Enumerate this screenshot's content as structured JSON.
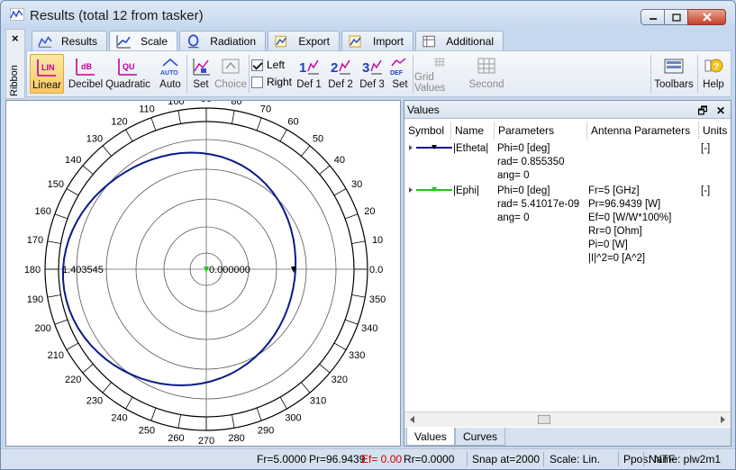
{
  "window": {
    "title": "Results (total 12 from tasker)"
  },
  "ribbon": {
    "label": "Ribbon",
    "close_icon": "×"
  },
  "tabs": [
    {
      "label": "Results"
    },
    {
      "label": "Scale"
    },
    {
      "label": "Radiation"
    },
    {
      "label": "Export"
    },
    {
      "label": "Import"
    },
    {
      "label": "Additional"
    }
  ],
  "toolbar": {
    "linear": "Linear",
    "decibel": "Decibel",
    "quadratic": "Quadratic",
    "auto": "Auto",
    "set": "Set",
    "choice": "Choice",
    "left": "Left",
    "right": "Right",
    "def1": "Def 1",
    "def2": "Def 2",
    "def3": "Def 3",
    "set2": "Set",
    "grid_values": "Grid Values",
    "second": "Second",
    "toolbars": "Toolbars",
    "help": "Help",
    "icon_lin": "LIN",
    "icon_db": "dB",
    "icon_qu": "QU",
    "icon_auto": "AUTO",
    "icon_def1": "1",
    "icon_def2": "2",
    "icon_def3": "3",
    "icon_def": "DEF"
  },
  "plot": {
    "center_value": "0.000000",
    "edge_value": "1.403545",
    "right_value": "0.0",
    "angle_labels": [
      "0",
      "10",
      "20",
      "30",
      "40",
      "50",
      "60",
      "70",
      "80",
      "90",
      "100",
      "110",
      "120",
      "130",
      "140",
      "150",
      "160",
      "170",
      "180",
      "190",
      "200",
      "210",
      "220",
      "230",
      "240",
      "250",
      "260",
      "270",
      "280",
      "290",
      "300",
      "310",
      "320",
      "330",
      "340",
      "350"
    ]
  },
  "values_panel": {
    "title": "Values",
    "columns": [
      "Symbol",
      "Name",
      "Parameters",
      "Antenna Parameters",
      "Units"
    ],
    "rows": [
      {
        "name": "|Etheta|",
        "color": "#0a1a8c",
        "params": [
          "Phi=0 [deg]",
          "rad= 0.855350",
          "ang= 0"
        ],
        "antenna": [],
        "units": "[-]"
      },
      {
        "name": "|Ephi|",
        "color": "#1fc81f",
        "params": [
          "Phi=0 [deg]",
          "rad= 5.41017e-09",
          "ang= 0"
        ],
        "antenna": [
          "Fr=5 [GHz]",
          "Pr=96.9439 [W]",
          "Ef=0 [W/W*100%]",
          "Rr=0 [Ohm]",
          "Pi=0 [W]",
          "|I|^2=0 [A^2]"
        ],
        "units": "[-]"
      }
    ],
    "bottom_tabs": [
      "Values",
      "Curves"
    ]
  },
  "status": {
    "fr": "Fr=5.0000",
    "pr": "Pr=96.9439",
    "ef": "Ef= 0.00",
    "rr": "Rr=0.0000",
    "snap": "Snap at=2000",
    "scale": "Scale: Lin.",
    "ppos": "Ppos: NTF",
    "name": "Name: plw2m1",
    "ef_color": "#d40000"
  }
}
